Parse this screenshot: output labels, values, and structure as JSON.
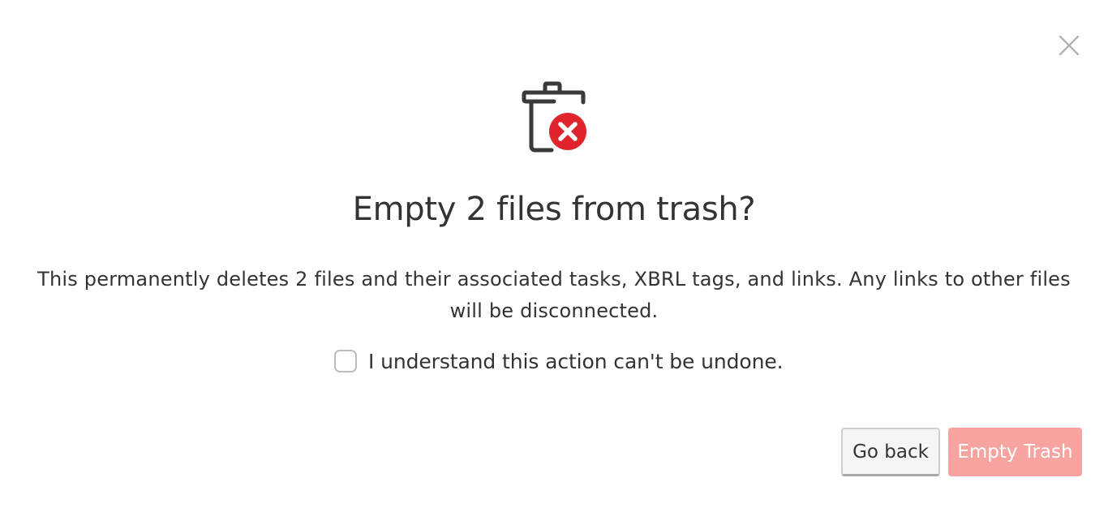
{
  "dialog": {
    "title": "Empty 2 files from trash?",
    "message": "This permanently deletes 2 files and their associated tasks, XBRL tags, and links. Any links to other files will be disconnected.",
    "confirm_checkbox": {
      "label": "I understand this action can't be undone.",
      "checked": false
    },
    "buttons": {
      "go_back": "Go back",
      "empty_trash": "Empty Trash"
    },
    "icons": {
      "close": "close-icon",
      "main": "trash-error-icon"
    },
    "colors": {
      "error_red": "#e0242c",
      "disabled_danger": "#f7a4a0",
      "text": "#333333"
    }
  }
}
